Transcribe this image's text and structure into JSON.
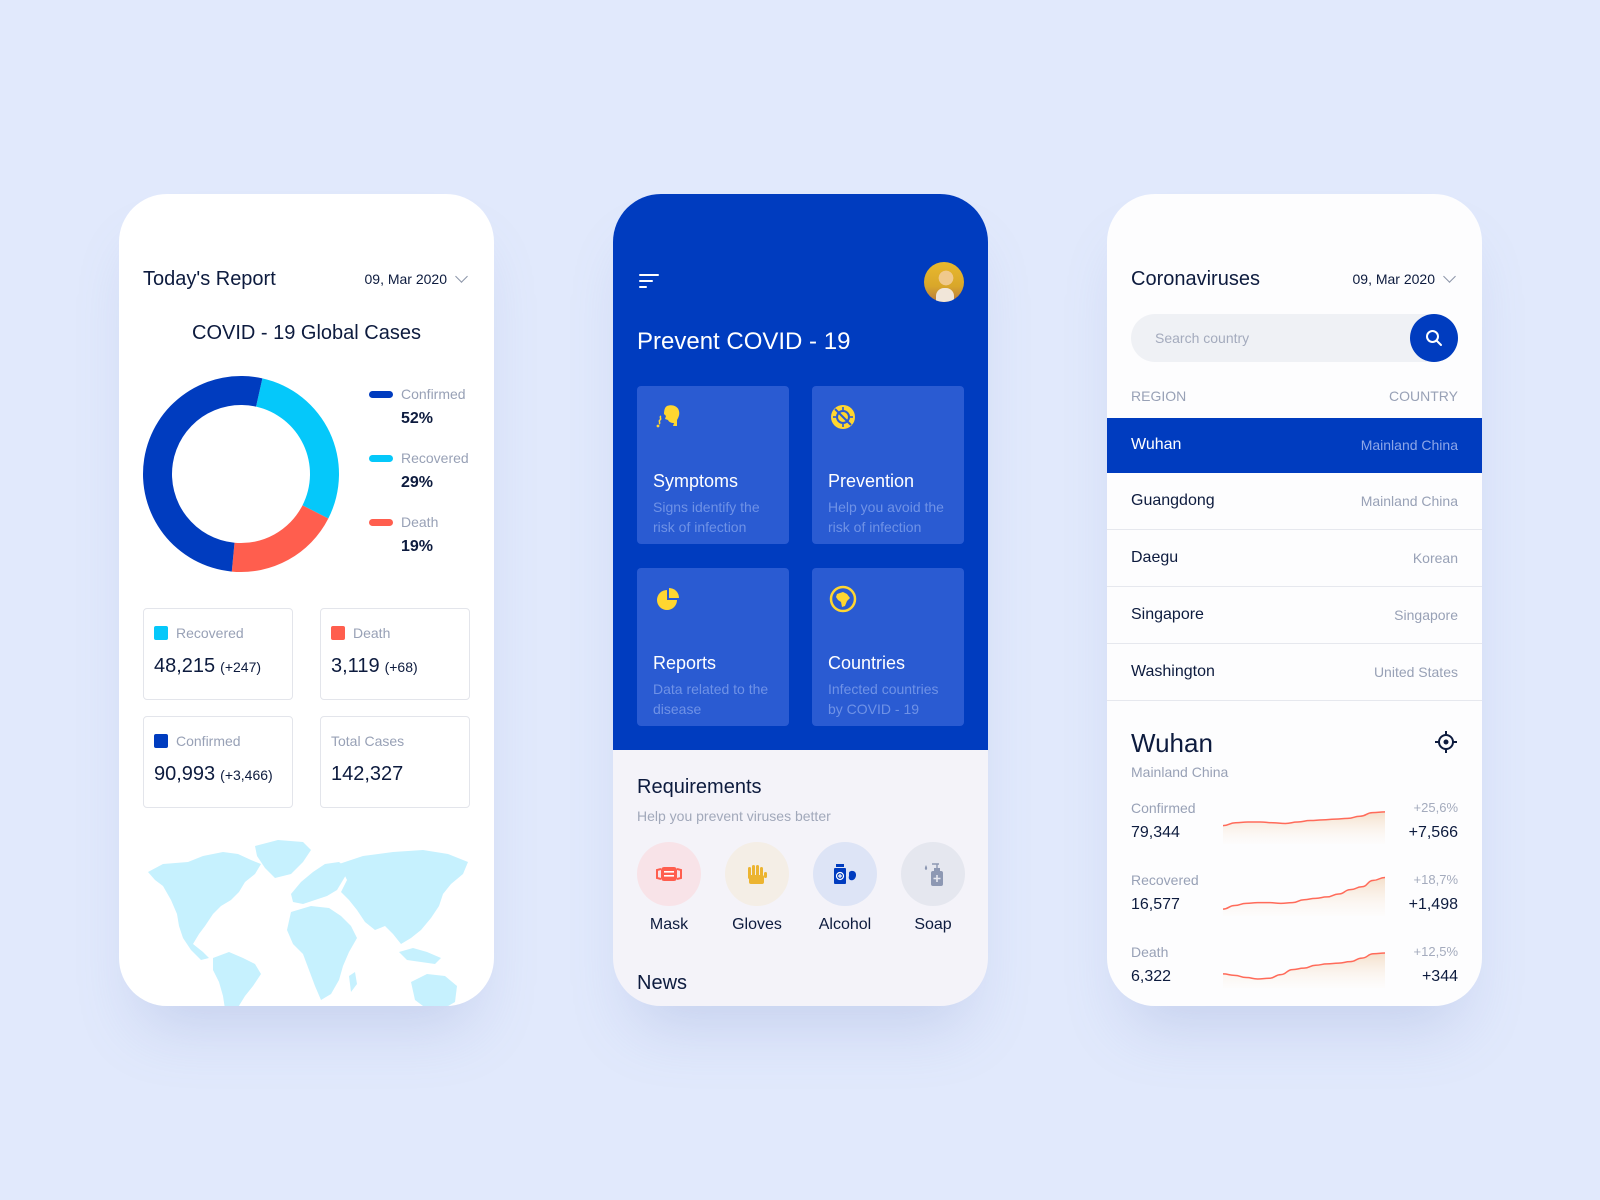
{
  "colors": {
    "background": "#e1e9fc",
    "primary": "#003cbf",
    "confirmed": "#003cbf",
    "recovered": "#05c8fa",
    "death": "#ff5e4e",
    "map": "#c6f1fe",
    "feature_card": "#2a5bd2",
    "icon_yellow": "#ffd630"
  },
  "report_screen": {
    "title": "Today's Report",
    "date": "09, Mar 2020",
    "chart_title": "COVID - 19 Global Cases",
    "legend": [
      {
        "label": "Confirmed",
        "value": "52%",
        "color": "#003cbf"
      },
      {
        "label": "Recovered",
        "value": "29%",
        "color": "#05c8fa"
      },
      {
        "label": "Death",
        "value": "19%",
        "color": "#ff5e4e"
      }
    ],
    "stats": [
      {
        "label": "Recovered",
        "value": "48,215",
        "delta": "(+247)",
        "color": "#05c8fa"
      },
      {
        "label": "Death",
        "value": "3,119",
        "delta": "(+68)",
        "color": "#ff5e4e"
      },
      {
        "label": "Confirmed",
        "value": "90,993",
        "delta": "(+3,466)",
        "color": "#003cbf"
      },
      {
        "label": "Total Cases",
        "value": "142,327",
        "delta": "",
        "color": ""
      }
    ]
  },
  "chart_data": {
    "type": "pie",
    "variant": "donut",
    "title": "COVID - 19 Global Cases",
    "categories": [
      "Confirmed",
      "Recovered",
      "Death"
    ],
    "values": [
      52,
      29,
      19
    ],
    "unit": "%",
    "legend": "right"
  },
  "prevent_screen": {
    "title": "Prevent COVID - 19",
    "features": [
      {
        "icon": "symptoms-icon",
        "title": "Symptoms",
        "desc": "Signs identify the risk of infection"
      },
      {
        "icon": "prevention-icon",
        "title": "Prevention",
        "desc": "Help you avoid the risk of infection"
      },
      {
        "icon": "reports-icon",
        "title": "Reports",
        "desc": "Data related to the disease"
      },
      {
        "icon": "countries-icon",
        "title": "Countries",
        "desc": "Infected countries by COVID - 19"
      }
    ],
    "requirements_title": "Requirements",
    "requirements_subtitle": "Help you prevent viruses better",
    "requirements": [
      {
        "icon": "mask-icon",
        "label": "Mask",
        "bg": "#f8e3e8"
      },
      {
        "icon": "gloves-icon",
        "label": "Gloves",
        "bg": "#f4eee6"
      },
      {
        "icon": "alcohol-icon",
        "label": "Alcohol",
        "bg": "#dde4f6"
      },
      {
        "icon": "soap-icon",
        "label": "Soap",
        "bg": "#e5e7ef"
      }
    ],
    "news_title": "News"
  },
  "list_screen": {
    "title": "Coronaviruses",
    "date": "09, Mar 2020",
    "search_placeholder": "Search country",
    "col_region": "REGION",
    "col_country": "COUNTRY",
    "regions": [
      {
        "region": "Wuhan",
        "country": "Mainland China",
        "selected": true
      },
      {
        "region": "Guangdong",
        "country": "Mainland China",
        "selected": false
      },
      {
        "region": "Daegu",
        "country": "Korean",
        "selected": false
      },
      {
        "region": "Singapore",
        "country": "Singapore",
        "selected": false
      },
      {
        "region": "Washington",
        "country": "United States",
        "selected": false
      }
    ],
    "detail": {
      "title": "Wuhan",
      "subtitle": "Mainland China",
      "trends": [
        {
          "label": "Confirmed",
          "value": "79,344",
          "pct": "+25,6%",
          "delta": "+7,566",
          "series": [
            20,
            24,
            25,
            25,
            24,
            23,
            25,
            27,
            28,
            29,
            30,
            33,
            38,
            39
          ]
        },
        {
          "label": "Recovered",
          "value": "16,577",
          "series": [
            4,
            9,
            12,
            13,
            13,
            12,
            13,
            17,
            19,
            21,
            25,
            31,
            35,
            44,
            48
          ],
          "pct": "+18,7%",
          "delta": "+1,498"
        },
        {
          "label": "Death",
          "value": "6,322",
          "pct": "+12,5%",
          "delta": "+344",
          "series": [
            14,
            12,
            9,
            7,
            8,
            13,
            20,
            22,
            26,
            28,
            29,
            31,
            36,
            42,
            43
          ]
        }
      ]
    }
  }
}
